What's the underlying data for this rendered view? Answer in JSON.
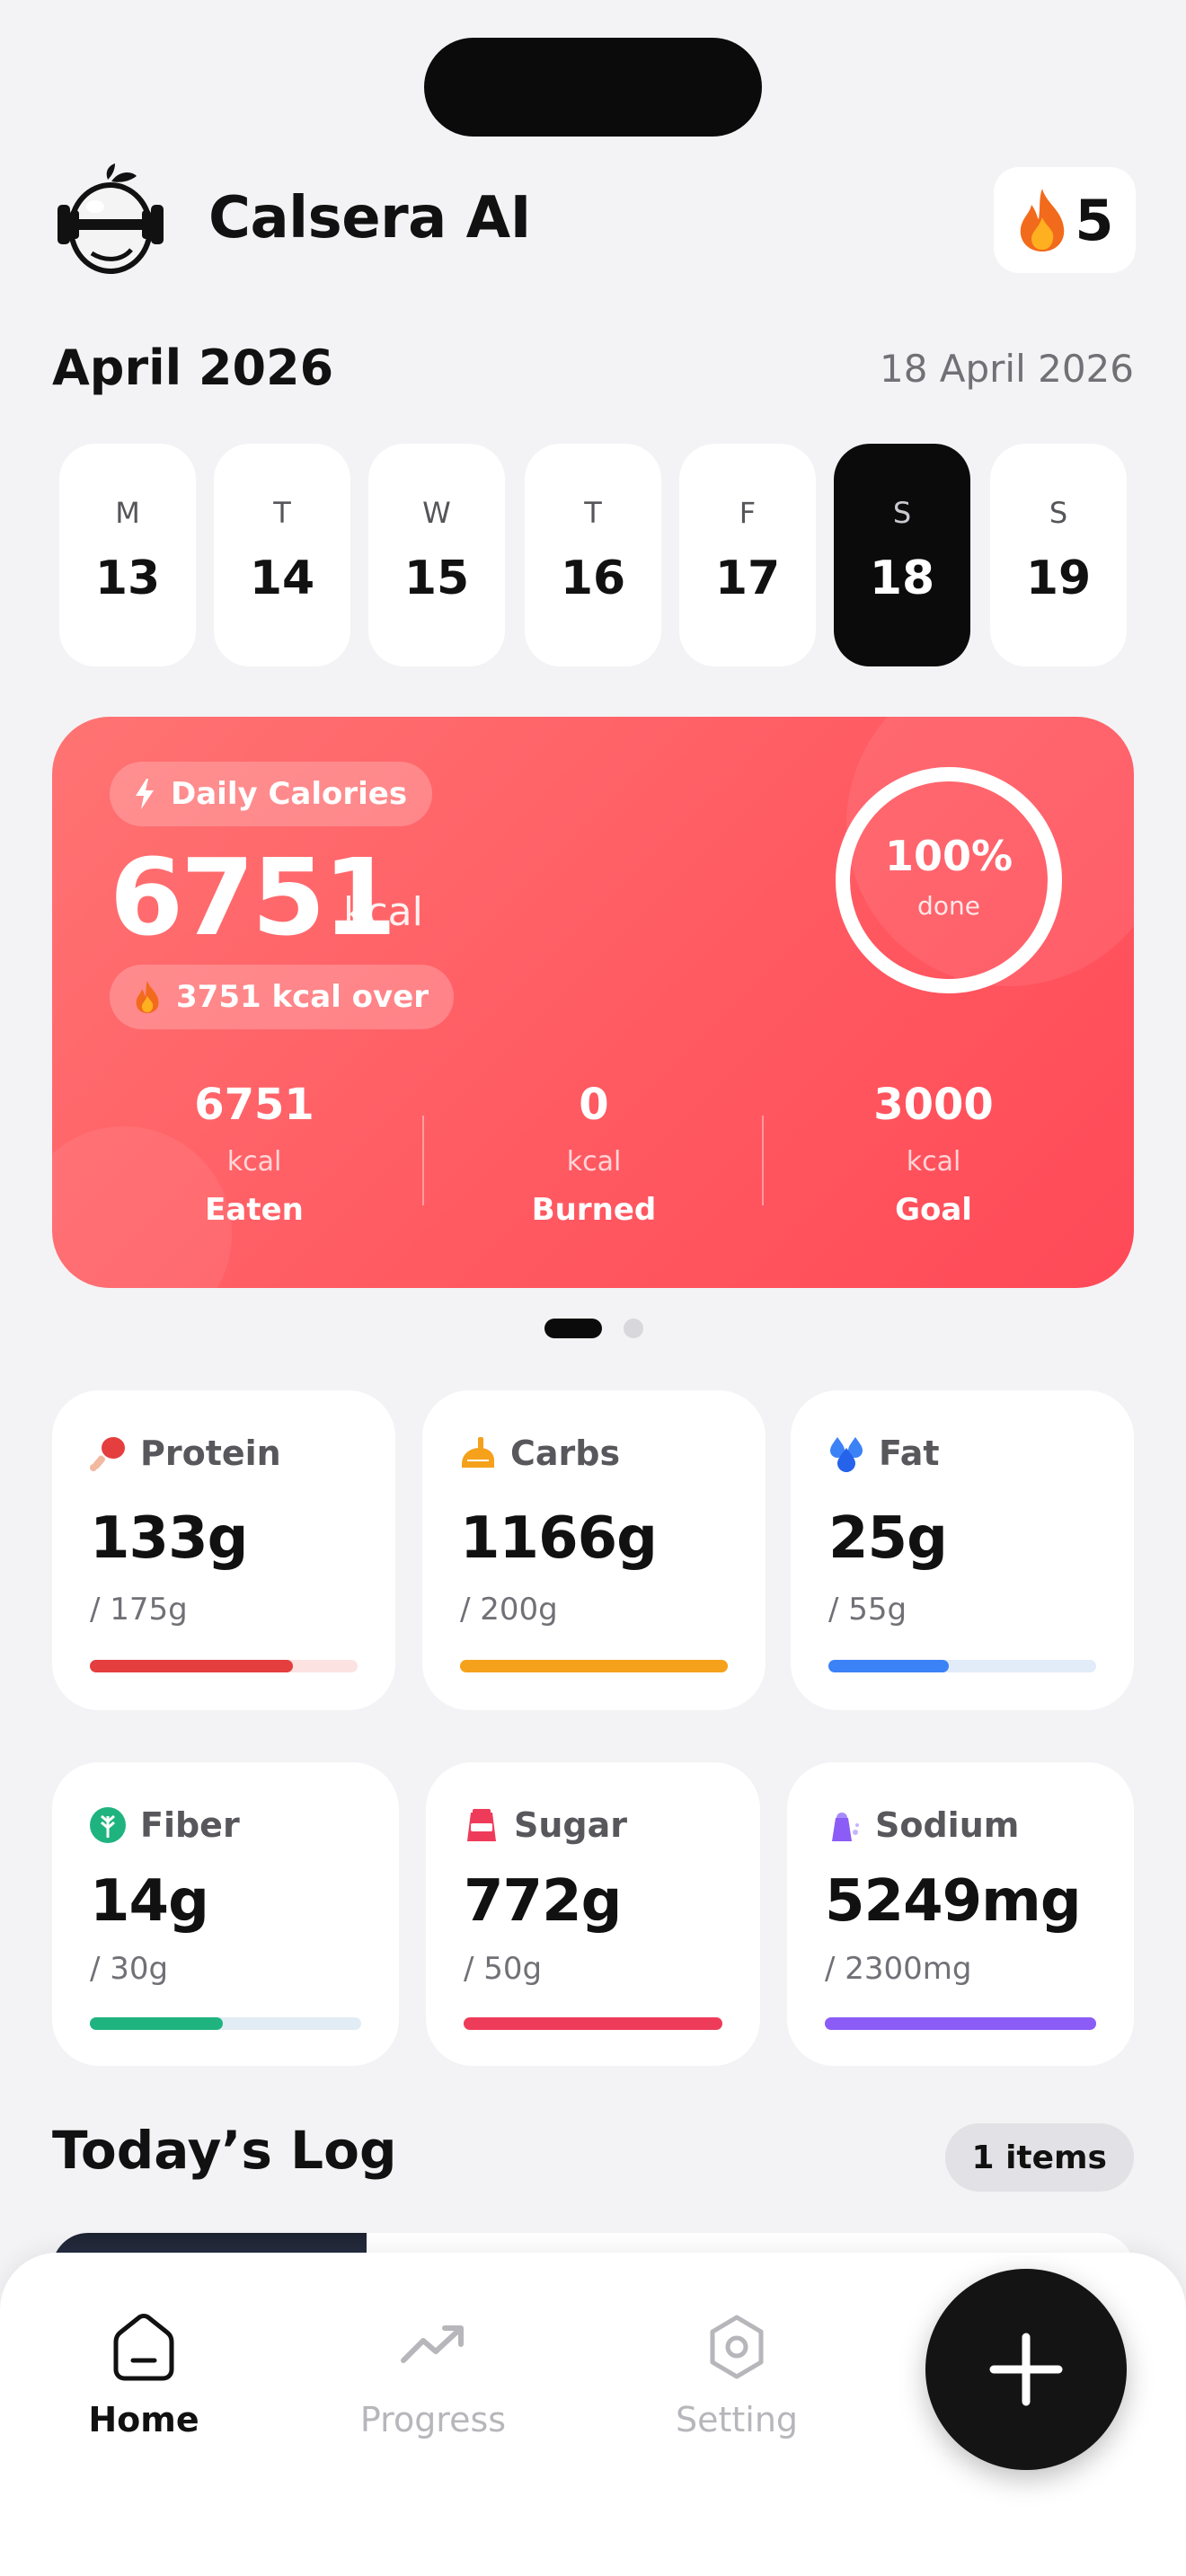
{
  "app": {
    "title": "Calsera AI",
    "streak_count": "5"
  },
  "calendar": {
    "month_label": "April 2026",
    "selected_date_label": "18 April 2026",
    "days": [
      {
        "letter": "M",
        "number": "13",
        "selected": false
      },
      {
        "letter": "T",
        "number": "14",
        "selected": false
      },
      {
        "letter": "W",
        "number": "15",
        "selected": false
      },
      {
        "letter": "T",
        "number": "16",
        "selected": false
      },
      {
        "letter": "F",
        "number": "17",
        "selected": false
      },
      {
        "letter": "S",
        "number": "18",
        "selected": true
      },
      {
        "letter": "S",
        "number": "19",
        "selected": false
      }
    ]
  },
  "calories": {
    "pill_label": "Daily Calories",
    "value": "6751",
    "unit": "kcal",
    "over_label": "3751 kcal over",
    "progress_percent": 100,
    "progress_label": "100%",
    "progress_caption": "done",
    "stats": [
      {
        "value": "6751",
        "unit": "kcal",
        "label": "Eaten"
      },
      {
        "value": "0",
        "unit": "kcal",
        "label": "Burned"
      },
      {
        "value": "3000",
        "unit": "kcal",
        "label": "Goal"
      }
    ],
    "gradient_colors": [
      "#ff7373",
      "#ff4a58"
    ]
  },
  "pager": {
    "pages": 2,
    "active_index": 0
  },
  "macros": [
    {
      "name": "Protein",
      "value": "133g",
      "goal": "/ 175g",
      "progress": 0.76,
      "color": "#e53e3e",
      "track": "#fde2e2",
      "icon": "drumstick-icon"
    },
    {
      "name": "Carbs",
      "value": "1166g",
      "goal": "/ 200g",
      "progress": 1.0,
      "color": "#f5a11c",
      "track": "#fdecc8",
      "icon": "bread-icon"
    },
    {
      "name": "Fat",
      "value": "25g",
      "goal": "/ 55g",
      "progress": 0.45,
      "color": "#3b82f6",
      "track": "#e1ecf8",
      "icon": "fat-drops-icon"
    },
    {
      "name": "Fiber",
      "value": "14g",
      "goal": "/ 30g",
      "progress": 0.49,
      "color": "#1fb380",
      "track": "#e1ecf4",
      "icon": "fiber-leaf-icon"
    },
    {
      "name": "Sugar",
      "value": "772g",
      "goal": "/ 50g",
      "progress": 1.0,
      "color": "#ef3b5a",
      "track": "#fde2e6",
      "icon": "sugar-bag-icon"
    },
    {
      "name": "Sodium",
      "value": "5249mg",
      "goal": "/ 2300mg",
      "progress": 1.0,
      "color": "#8b5cf6",
      "track": "#ede5fd",
      "icon": "salt-shaker-icon"
    }
  ],
  "log": {
    "title": "Today’s Log",
    "count_label": "1 items"
  },
  "nav": {
    "items": [
      {
        "label": "Home",
        "icon": "home-icon",
        "active": true
      },
      {
        "label": "Progress",
        "icon": "trend-icon",
        "active": false
      },
      {
        "label": "Setting",
        "icon": "settings-hex-icon",
        "active": false
      }
    ],
    "fab_icon": "plus-icon"
  }
}
